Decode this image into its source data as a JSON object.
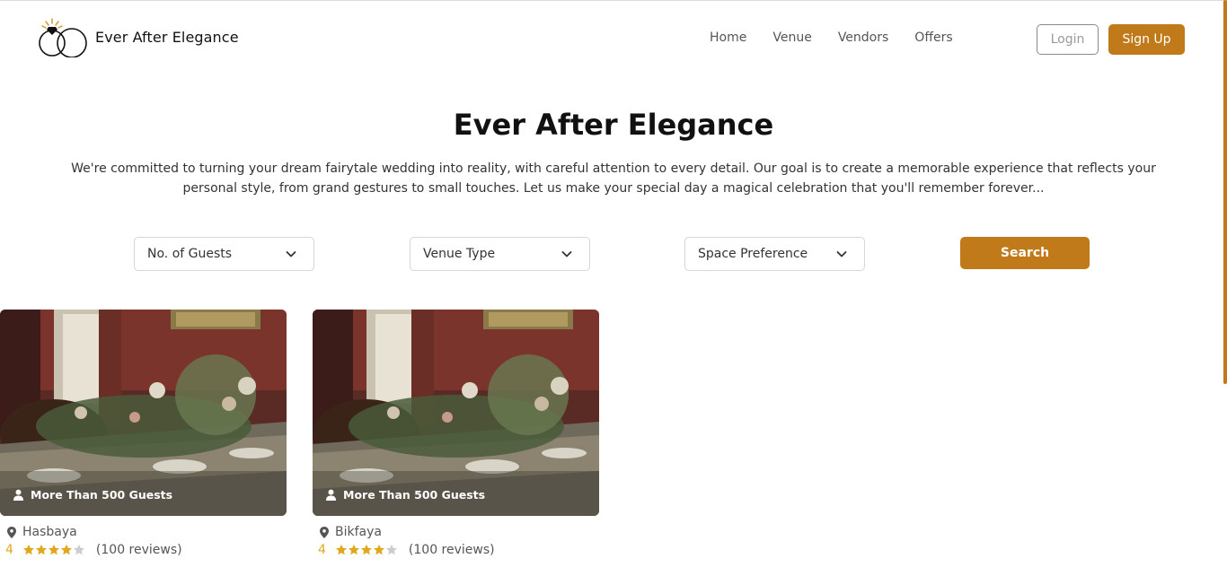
{
  "header": {
    "brand": "Ever After Elegance",
    "nav": [
      "Home",
      "Venue",
      "Vendors",
      "Offers"
    ],
    "login_label": "Login",
    "signup_label": "Sign Up"
  },
  "hero": {
    "title": "Ever After Elegance",
    "description": "We're committed to turning your dream fairytale wedding into reality, with careful attention to every detail. Our goal is to create a memorable experience that reflects your personal style, from grand gestures to small touches. Let us make your special day a magical celebration that you'll remember forever..."
  },
  "filters": {
    "guests": "No. of Guests",
    "venue_type": "Venue Type",
    "space": "Space Preference",
    "search_label": "Search"
  },
  "venues": [
    {
      "badge": "More Than 500 Guests",
      "location": "Hasbaya",
      "rating": "4",
      "stars": 4,
      "reviews": "(100 reviews)"
    },
    {
      "badge": "More Than 500 Guests",
      "location": "Bikfaya",
      "rating": "4",
      "stars": 4,
      "reviews": "(100 reviews)"
    }
  ],
  "colors": {
    "accent": "#c07a1a",
    "star": "#e0a81a",
    "star_empty": "#cccccc"
  },
  "icons": [
    "rings-logo-icon",
    "chevron-down-icon",
    "user-icon",
    "location-pin-icon",
    "star-icon"
  ]
}
